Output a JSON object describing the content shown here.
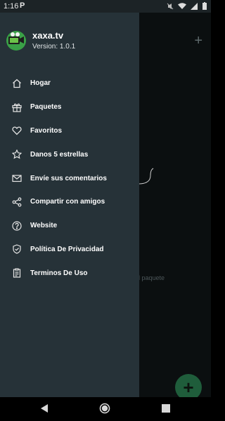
{
  "status_bar": {
    "time": "1:16",
    "app_indicator": "P"
  },
  "app": {
    "name": "xaxa.tv",
    "version": "Version: 1.0.1",
    "empty_state_text": "l paquete"
  },
  "drawer": {
    "items": [
      {
        "label": "Hogar",
        "icon": "home-icon"
      },
      {
        "label": "Paquetes",
        "icon": "gift-icon"
      },
      {
        "label": "Favoritos",
        "icon": "heart-icon"
      },
      {
        "label": "Danos 5 estrellas",
        "icon": "star-icon"
      },
      {
        "label": "Envíe sus comentarios",
        "icon": "mail-icon"
      },
      {
        "label": "Compartir con amigos",
        "icon": "share-icon"
      },
      {
        "label": "Website",
        "icon": "help-circle-icon"
      },
      {
        "label": "Política De Privacidad",
        "icon": "shield-check-icon"
      },
      {
        "label": "Terminos De Uso",
        "icon": "clipboard-icon"
      }
    ]
  },
  "colors": {
    "drawer_bg": "#263238",
    "fab": "#1f5d3b",
    "logo_green": "#2c8a39"
  }
}
